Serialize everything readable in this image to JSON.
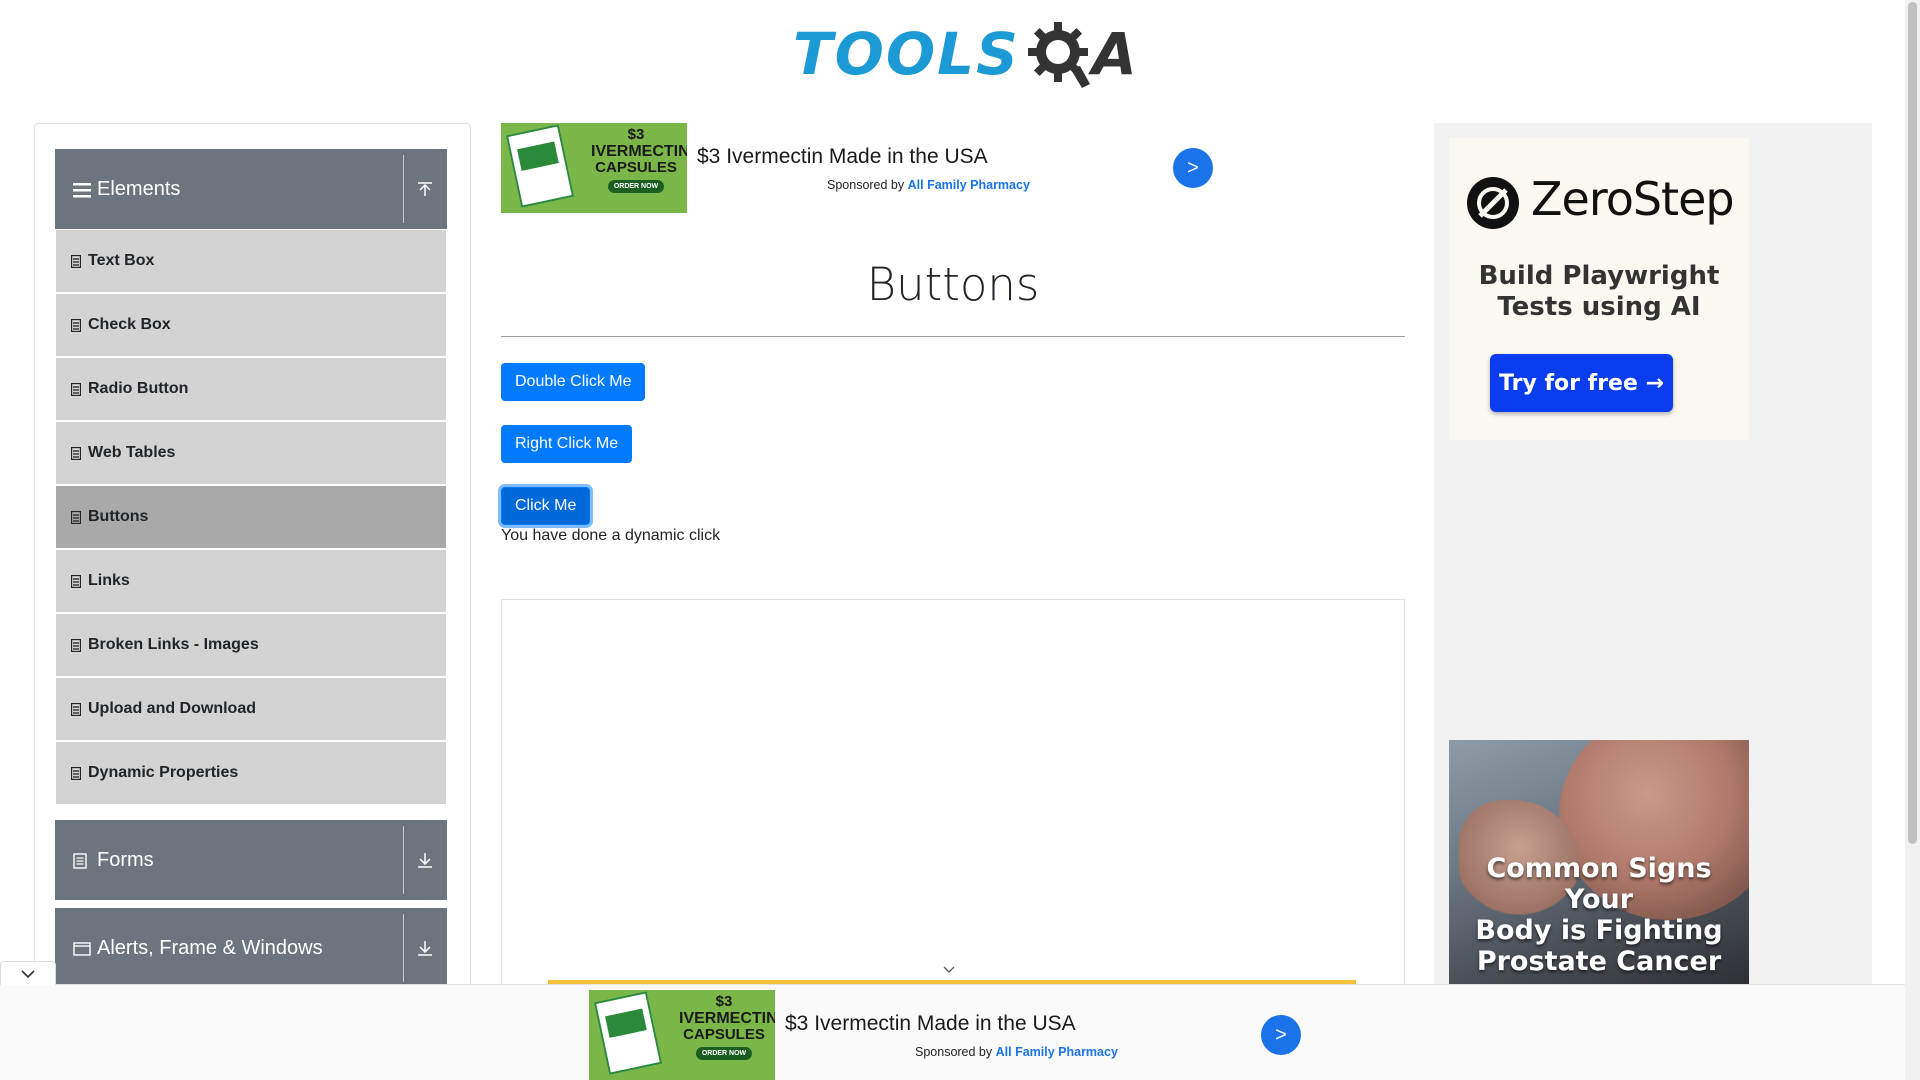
{
  "header": {
    "logo_part1": "TOOLS",
    "logo_part2": "A"
  },
  "sidebar": {
    "groups": [
      {
        "label": "Elements",
        "icon": "menu-icon",
        "expanded": true
      },
      {
        "label": "Forms",
        "icon": "document-icon",
        "expanded": false
      },
      {
        "label": "Alerts, Frame & Windows",
        "icon": "window-icon",
        "expanded": false
      }
    ],
    "items": [
      {
        "label": "Text Box"
      },
      {
        "label": "Check Box"
      },
      {
        "label": "Radio Button"
      },
      {
        "label": "Web Tables"
      },
      {
        "label": "Buttons",
        "active": true
      },
      {
        "label": "Links"
      },
      {
        "label": "Broken Links - Images"
      },
      {
        "label": "Upload and Download"
      },
      {
        "label": "Dynamic Properties"
      }
    ]
  },
  "top_ad": {
    "img_price": "$3",
    "img_line1": "IVERMECTIN",
    "img_line2": "CAPSULES",
    "img_order": "ORDER NOW",
    "title": "$3 Ivermectin Made in the USA",
    "sponsored_prefix": "Sponsored by",
    "sponsor": "All Family Pharmacy",
    "cta": ">"
  },
  "main": {
    "title": "Buttons",
    "double_click_label": "Double Click Me",
    "right_click_label": "Right Click Me",
    "click_label": "Click Me",
    "dynamic_message": "You have done a dynamic click"
  },
  "right_ads": {
    "zerostep_name": "ZeroStep",
    "zerostep_tagline_1": "Build Playwright",
    "zerostep_tagline_2": "Tests using AI",
    "zerostep_cta": "Try for free →",
    "prostate_line1": "Common Signs Your",
    "prostate_line2": "Body is Fighting",
    "prostate_line3": "Prostate Cancer"
  },
  "bottom_ad": {
    "img_price": "$3",
    "img_line1": "IVERMECTIN",
    "img_line2": "CAPSULES",
    "img_order": "ORDER NOW",
    "title": "$3 Ivermectin Made in the USA",
    "sponsored_prefix": "Sponsored by",
    "sponsor": "All Family Pharmacy",
    "cta": ">"
  },
  "colors": {
    "primary": "#007bff",
    "logo_blue": "#1c9ad6",
    "sidebar_header": "#6c757d",
    "sidebar_item": "#d3d3d3",
    "sidebar_active": "#a9a9a9",
    "zerostep_button": "#0a3cf0"
  }
}
